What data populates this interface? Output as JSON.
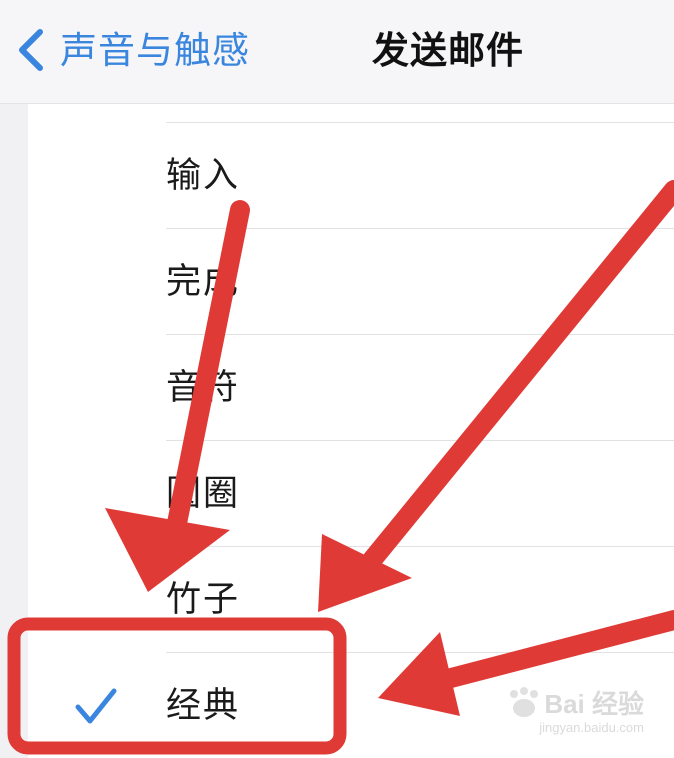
{
  "nav": {
    "back_label": "声音与触感",
    "title": "发送邮件"
  },
  "list": {
    "items": [
      {
        "label": "输入",
        "selected": false
      },
      {
        "label": "完成",
        "selected": false
      },
      {
        "label": "音符",
        "selected": false
      },
      {
        "label": "圆圈",
        "selected": false
      },
      {
        "label": "竹子",
        "selected": false
      },
      {
        "label": "经典",
        "selected": true
      }
    ]
  },
  "colors": {
    "accent": "#3a86de",
    "annotation": "#e03a36"
  },
  "icons": {
    "back": "chevron-left-icon",
    "selected": "checkmark-icon"
  },
  "watermark": {
    "text": "Bai 经验",
    "url": "jingyan.baidu.com"
  }
}
